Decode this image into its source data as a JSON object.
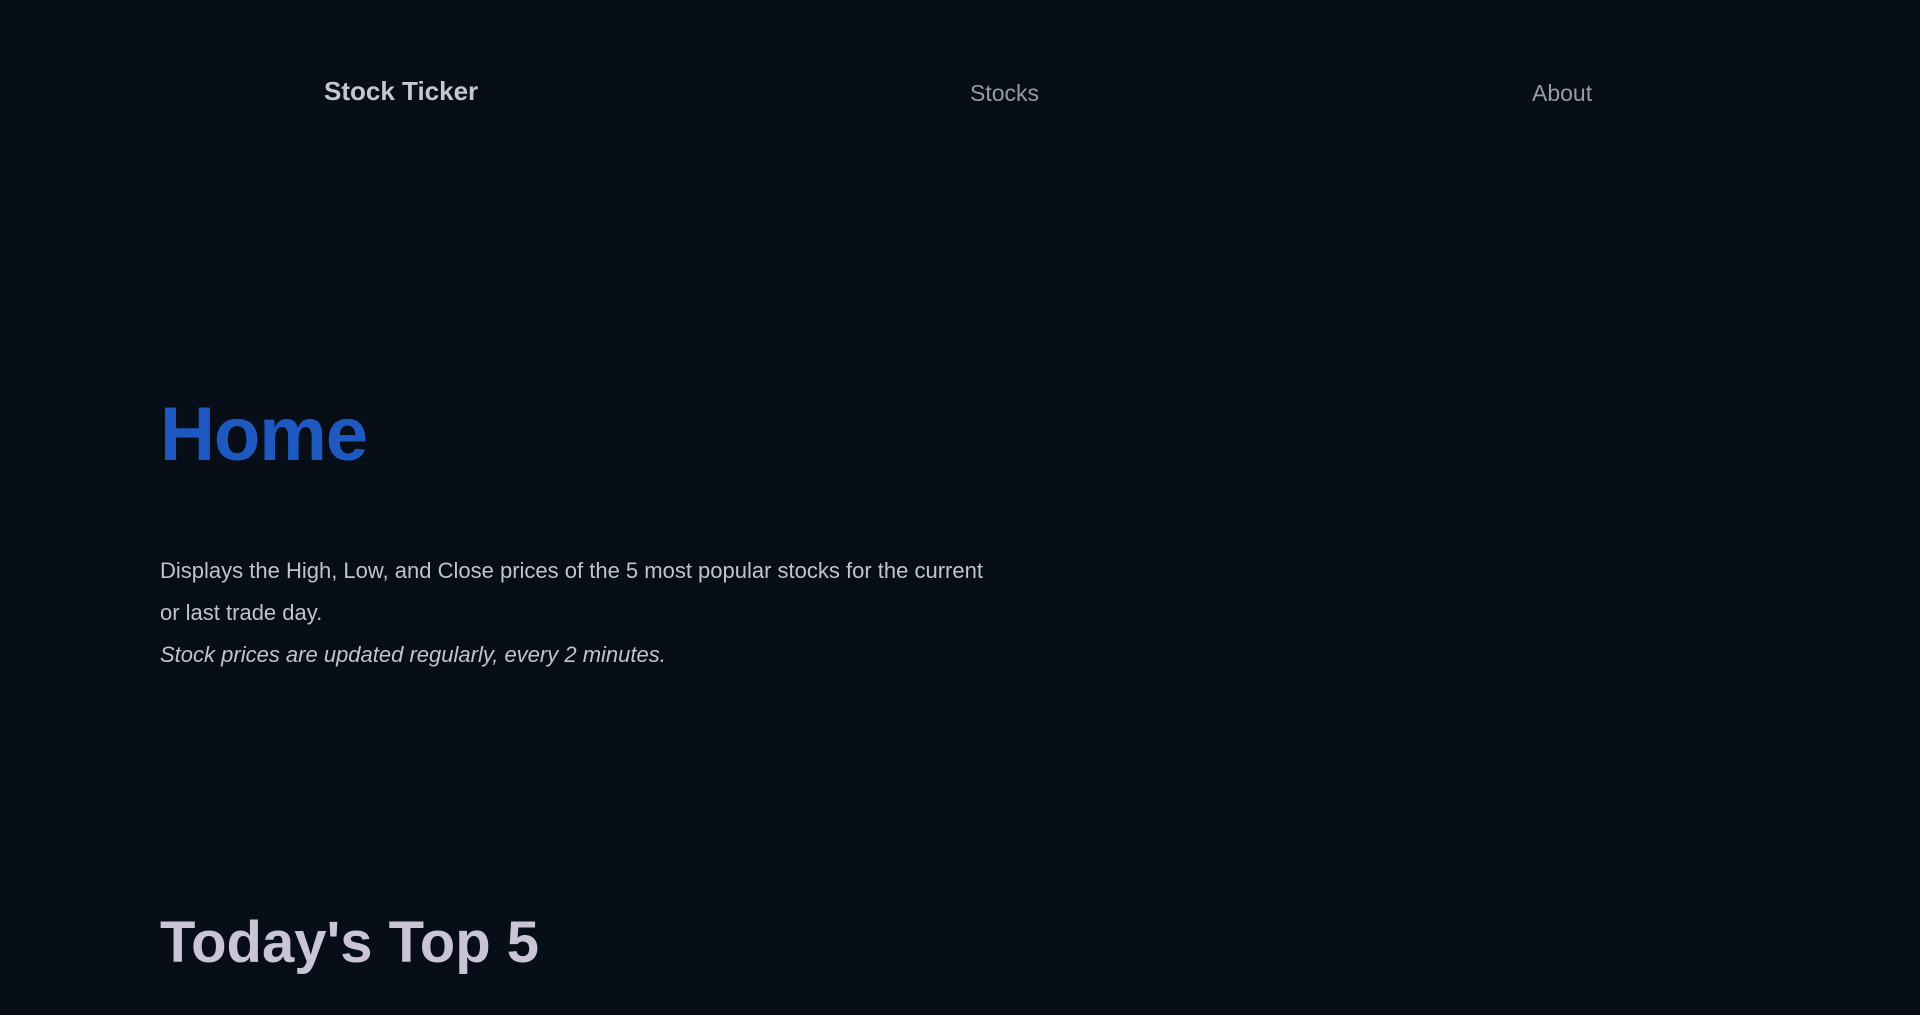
{
  "nav": {
    "brand": "Stock Ticker",
    "links": [
      {
        "label": "Stocks"
      },
      {
        "label": "About"
      }
    ]
  },
  "main": {
    "title": "Home",
    "description": "Displays the High, Low, and Close prices of the 5 most popular stocks for the current or last trade day.",
    "update_note": "Stock prices are updated regularly, every 2 minutes.",
    "section_title": "Today's Top 5"
  },
  "colors": {
    "background": "#070e18",
    "title_accent": "#1d59c0",
    "text": "#c3c2ce",
    "nav_link": "#9a9aa8"
  }
}
